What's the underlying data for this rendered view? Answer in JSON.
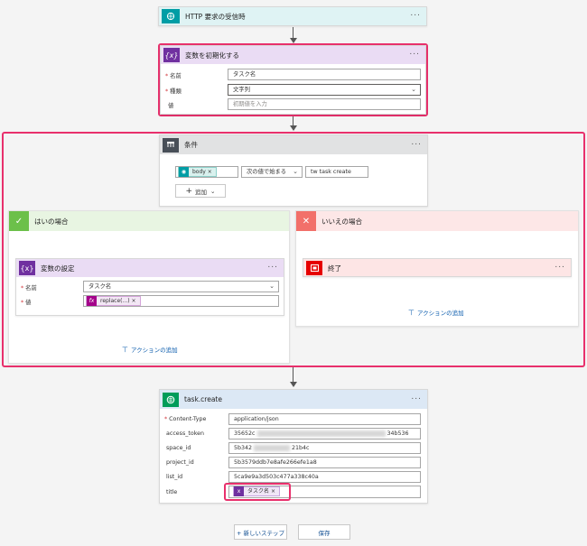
{
  "http_trigger": {
    "title": "HTTP 要求の受信時"
  },
  "init_var": {
    "title": "変数を初期化する",
    "name_label": "名前",
    "type_label": "種類",
    "value_label": "値",
    "name_value": "タスク名",
    "type_value": "文字列",
    "value_placeholder": "初期値を入力"
  },
  "condition": {
    "title": "条件",
    "token": "body",
    "operator": "次の値で始まる",
    "value": "tw task create",
    "add_label": "追加"
  },
  "yes_branch": {
    "title": "はいの場合",
    "set_var_title": "変数の設定",
    "name_label": "名前",
    "value_label": "値",
    "name_value": "タスク名",
    "expr_token": "replace(...)",
    "add_action": "アクションの追加"
  },
  "no_branch": {
    "title": "いいえの場合",
    "terminate_title": "終了",
    "add_action": "アクションの追加"
  },
  "task_create": {
    "title": "task.create",
    "content_type_label": "Content-Type",
    "content_type_value": "application/json",
    "access_token_label": "access_token",
    "access_token_start": "35652c",
    "access_token_end": "34b536",
    "space_id_label": "space_id",
    "space_id_start": "5b342",
    "space_id_end": "21b4c",
    "project_id_label": "project_id",
    "project_id_value": "5b3579ddb7e8afe266efe1a8",
    "list_id_label": "list_id",
    "list_id_value": "5ca9e9a3d503c477a338c40a",
    "title_label": "title",
    "title_token": "タスク名"
  },
  "footer": {
    "new_step": "+ 新しいステップ",
    "save": "保存"
  },
  "colors": {
    "highlight": "#e8306c",
    "variable": "#7030a0",
    "condition": "#484f58",
    "http": "#009da5",
    "web": "#009c5a",
    "terminate": "#e60000"
  }
}
